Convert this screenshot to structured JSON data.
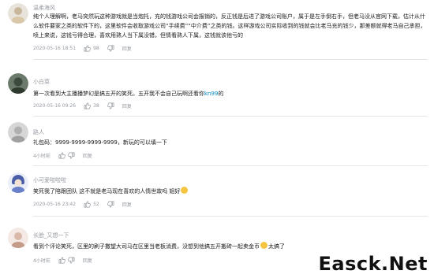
{
  "comments": [
    {
      "username": "温柔海风",
      "text": "纯个人理解啊，老马突然玩这种游戏就是当炮托，充的钱游戏公司会报销的，反正钱是后进了游戏公司账户，属于是左手倒右手，但老马没从官网下载，估计从什么软件要家之类的软件下的，这里软件会收取游戏公司“手续费”“中介费”之类的钱。这样游戏公司实际收到的钱就会比老马充的钱少，那差额就得老马自己承担，喷上来说，这钱亏得合理，喜欢用熟人当下属没错，但情看熟人下属，这钱就该他亏的",
      "time": "2020-05-16 18:51",
      "likes": "98",
      "reply": "回复"
    },
    {
      "username": "小白菜",
      "text_before": "第一次看到大主播播梦幻是搞五开的笑死。五开我不会自己玩啊还看你",
      "text_link": "kn99",
      "text_after": "的",
      "time": "2020-05-16 09:26",
      "likes": "38",
      "reply": "回复"
    },
    {
      "username": "路人",
      "text": "礼包码：9999-9999-9999-9999，新玩的可以填一下",
      "time": "4小时前",
      "likes": "",
      "reply": "回复"
    },
    {
      "username": "小可爱啦啦啦",
      "text": "笑死我了陪跟团队 这不就是老马现在喜欢的人情世故吗 姐好",
      "time": "2020-05-16 23:42",
      "likes": "52",
      "reply": "回复"
    },
    {
      "username": "长脸_又想一下",
      "text": "看到个评论笑死，区里的刷子撒望大司马在区里当老板消费，没想到他搞五开搬砖一起卖金币",
      "text_end": "太搞了",
      "time": "4小时前",
      "likes": "",
      "reply": "回复"
    }
  ],
  "watermark": "Easck.Net",
  "colors": {
    "muted": "#9499a0",
    "link": "#008ac5",
    "divider": "#e3e5e7"
  }
}
